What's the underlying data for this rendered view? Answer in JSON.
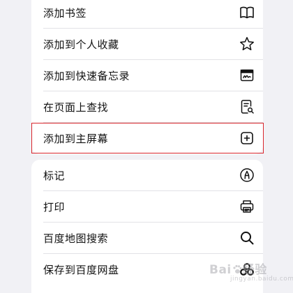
{
  "menu": {
    "group1": [
      {
        "label": "添加书签",
        "icon": "book-icon"
      },
      {
        "label": "添加到个人收藏",
        "icon": "star-icon"
      },
      {
        "label": "添加到快速备忘录",
        "icon": "quick-note-icon"
      },
      {
        "label": "在页面上查找",
        "icon": "find-in-page-icon"
      },
      {
        "label": "添加到主屏幕",
        "icon": "plus-square-icon"
      }
    ],
    "group2": [
      {
        "label": "标记",
        "icon": "markup-pen-icon"
      },
      {
        "label": "打印",
        "icon": "printer-icon"
      },
      {
        "label": "百度地图搜索",
        "icon": "search-icon"
      },
      {
        "label": "保存到百度网盘",
        "icon": "baidu-netdisk-icon"
      }
    ]
  },
  "highlight": {
    "item": "添加到主屏幕",
    "color": "#d9252b"
  },
  "watermark": {
    "text_left": "Bai",
    "text_right": "经验",
    "sub": "jingyan.baidu.com"
  },
  "colors": {
    "background": "#f1f1f5",
    "card": "#ffffff",
    "text": "#111111",
    "divider": "#e2e2e6"
  }
}
